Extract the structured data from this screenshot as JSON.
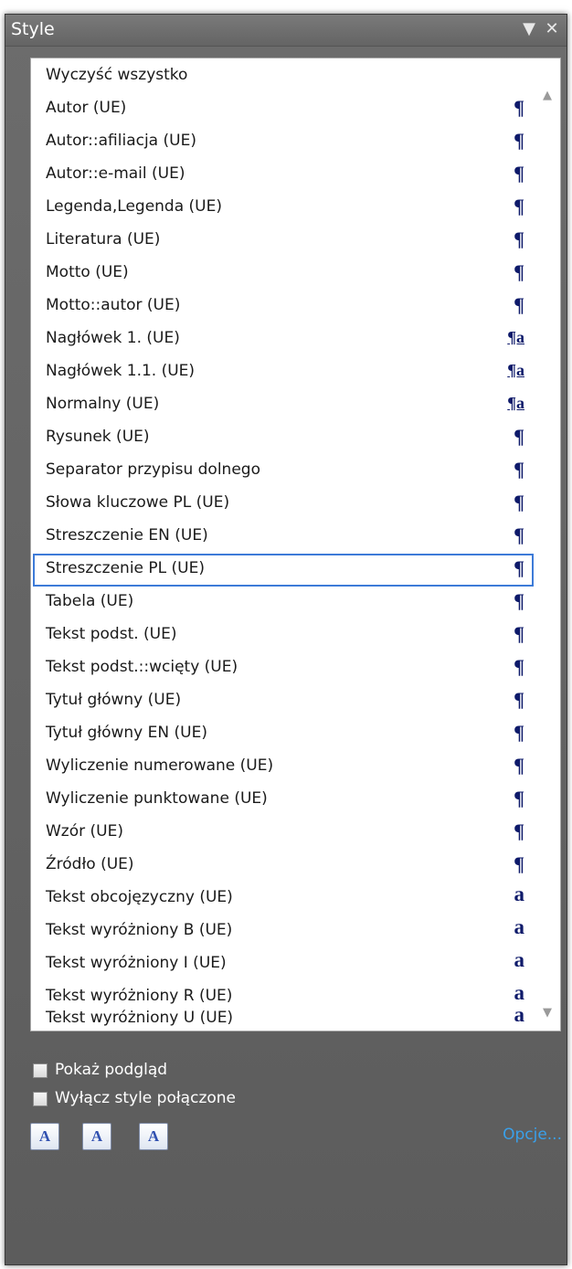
{
  "panel": {
    "title": "Style"
  },
  "titlebar": {
    "dropdown_glyph": "▼",
    "close_glyph": "✕"
  },
  "styles": [
    {
      "label": "Wyczyść wszystko",
      "icon": ""
    },
    {
      "label": "Autor (UE)",
      "icon": "¶"
    },
    {
      "label": "Autor::afiliacja (UE)",
      "icon": "¶"
    },
    {
      "label": "Autor::e-mail (UE)",
      "icon": "¶"
    },
    {
      "label": "Legenda,Legenda (UE)",
      "icon": "¶"
    },
    {
      "label": "Literatura (UE)",
      "icon": "¶"
    },
    {
      "label": "Motto (UE)",
      "icon": "¶"
    },
    {
      "label": "Motto::autor (UE)",
      "icon": "¶"
    },
    {
      "label": "Nagłówek 1. (UE)",
      "icon": "¶a"
    },
    {
      "label": "Nagłówek 1.1. (UE)",
      "icon": "¶a"
    },
    {
      "label": "Normalny (UE)",
      "icon": "¶a"
    },
    {
      "label": "Rysunek (UE)",
      "icon": "¶"
    },
    {
      "label": "Separator przypisu dolnego",
      "icon": "¶"
    },
    {
      "label": "Słowa kluczowe PL (UE)",
      "icon": "¶"
    },
    {
      "label": "Streszczenie EN (UE)",
      "icon": "¶"
    },
    {
      "label": "Streszczenie PL (UE)",
      "icon": "¶",
      "selected": true
    },
    {
      "label": "Tabela (UE)",
      "icon": "¶"
    },
    {
      "label": "Tekst podst. (UE)",
      "icon": "¶"
    },
    {
      "label": "Tekst podst.::wcięty (UE)",
      "icon": "¶"
    },
    {
      "label": "Tytuł główny (UE)",
      "icon": "¶"
    },
    {
      "label": "Tytuł główny EN (UE)",
      "icon": "¶"
    },
    {
      "label": "Wyliczenie numerowane (UE)",
      "icon": "¶"
    },
    {
      "label": "Wyliczenie punktowane (UE)",
      "icon": "¶"
    },
    {
      "label": "Wzór (UE)",
      "icon": "¶"
    },
    {
      "label": "Źródło (UE)",
      "icon": "¶"
    },
    {
      "label": "Tekst obcojęzyczny (UE)",
      "icon": "a"
    },
    {
      "label": "Tekst wyróżniony B (UE)",
      "icon": "a"
    },
    {
      "label": "Tekst wyróżniony I (UE)",
      "icon": "a"
    },
    {
      "label": "Tekst wyróżniony R (UE)",
      "icon": "a"
    },
    {
      "label": "Tekst wyróżniony U (UE)",
      "icon": "a"
    }
  ],
  "scrollbar": {
    "up_glyph": "▲",
    "down_glyph": "▼"
  },
  "options": {
    "show_preview_label": "Pokaż podgląd",
    "show_preview_checked": false,
    "disable_linked_label": "Wyłącz style połączone",
    "disable_linked_checked": false
  },
  "toolbar": {
    "new_style_glyph": "A",
    "style_inspector_glyph": "A",
    "manage_styles_glyph": "A",
    "options_link": "Opcje..."
  },
  "colors": {
    "panel_bg": "#5f5f5f",
    "selection_border": "#3d7bd8",
    "icon_color": "#0e1a6a",
    "link_color": "#3aa0ea"
  }
}
